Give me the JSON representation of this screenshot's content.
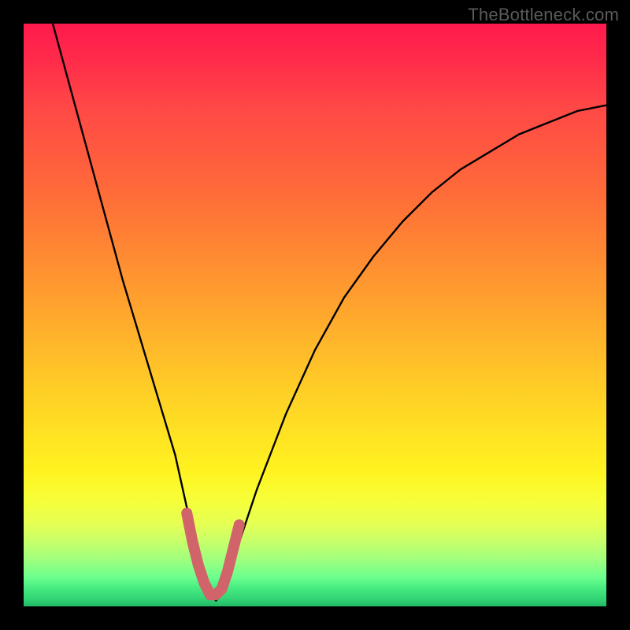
{
  "watermark": "TheBottleneck.com",
  "chart_data": {
    "type": "line",
    "title": "",
    "xlabel": "",
    "ylabel": "",
    "xlim": [
      0,
      100
    ],
    "ylim": [
      0,
      100
    ],
    "grid": false,
    "legend": false,
    "background": {
      "type": "vertical_gradient",
      "stops": [
        {
          "pos": 0,
          "color": "#ff1a4d"
        },
        {
          "pos": 50,
          "color": "#ff9c2f"
        },
        {
          "pos": 78,
          "color": "#fff320"
        },
        {
          "pos": 100,
          "color": "#21b965"
        }
      ]
    },
    "series": [
      {
        "name": "bottleneck-curve",
        "color": "#000000",
        "x": [
          5,
          8,
          11,
          14,
          17,
          20,
          23,
          26,
          28,
          30,
          31,
          32,
          33,
          34,
          35,
          37,
          40,
          45,
          50,
          55,
          60,
          65,
          70,
          75,
          80,
          85,
          90,
          95,
          100
        ],
        "values": [
          100,
          89,
          78,
          67,
          56,
          46,
          36,
          26,
          17,
          9,
          5,
          2,
          1,
          2,
          5,
          11,
          20,
          33,
          44,
          53,
          60,
          66,
          71,
          75,
          78,
          81,
          83,
          85,
          86
        ]
      },
      {
        "name": "optimal-marker",
        "color": "#d1636b",
        "x": [
          28,
          29,
          30,
          31,
          32,
          33,
          34,
          35,
          36,
          37
        ],
        "values": [
          16,
          11,
          7,
          4,
          2,
          2,
          3,
          6,
          10,
          14
        ]
      }
    ],
    "annotations": []
  }
}
